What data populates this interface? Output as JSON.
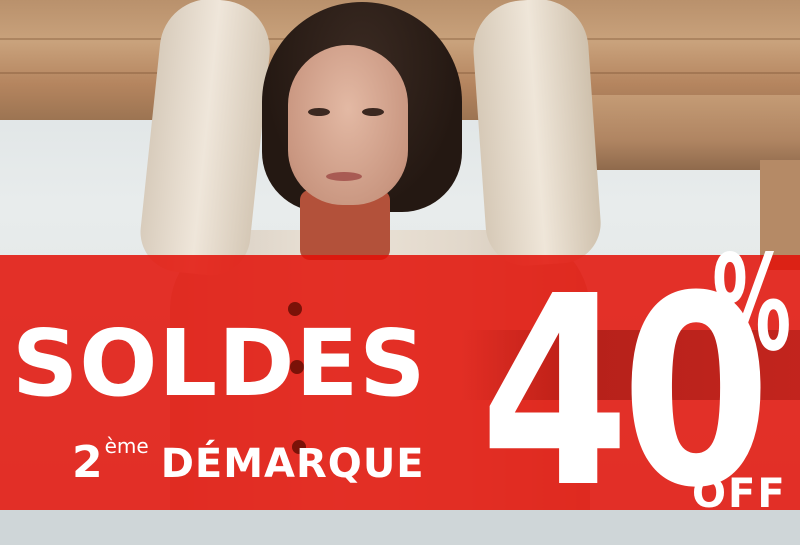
{
  "promo": {
    "headline": "SOLDES",
    "markdown_number": "2",
    "markdown_superscript": "ème",
    "markdown_word": "DÉMARQUE",
    "discount_value": "40",
    "discount_symbol": "%",
    "discount_suffix": "OFF"
  },
  "colors": {
    "band": "#e21208",
    "text": "#ffffff",
    "wood": "#c49b75"
  }
}
